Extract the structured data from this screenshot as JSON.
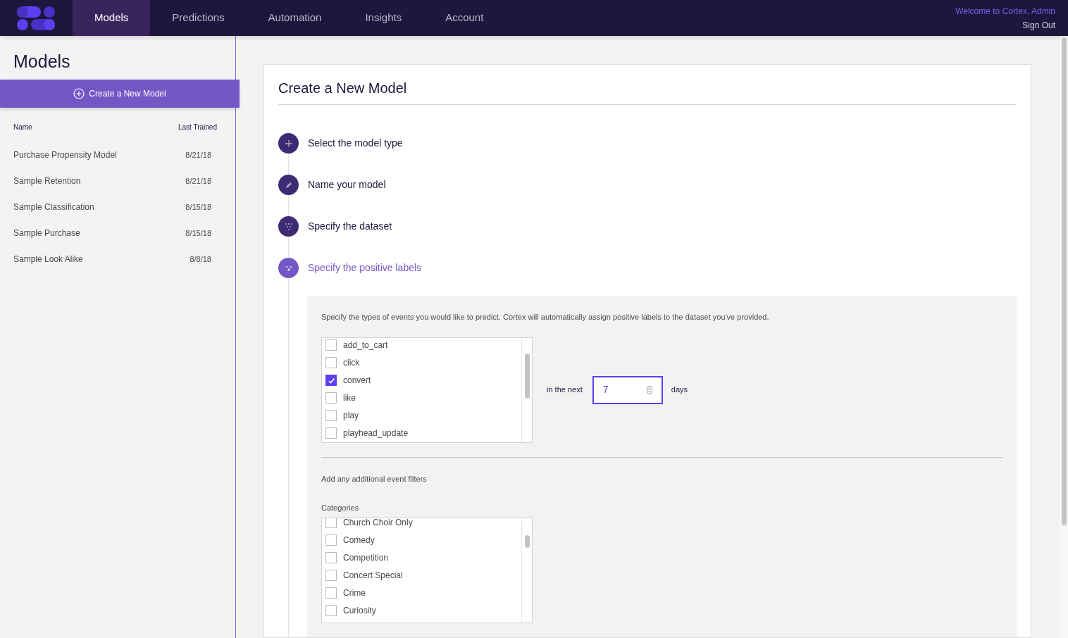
{
  "nav": {
    "tabs": [
      {
        "label": "Models",
        "selected": true
      },
      {
        "label": "Predictions",
        "selected": false
      },
      {
        "label": "Automation",
        "selected": false
      },
      {
        "label": "Insights",
        "selected": false
      },
      {
        "label": "Account",
        "selected": false
      }
    ],
    "welcome": "Welcome to Cortex, Admin",
    "sign_out": "Sign Out"
  },
  "sidebar": {
    "title": "Models",
    "create_button": "Create a New Model",
    "columns": [
      "Name",
      "Last Trained"
    ],
    "rows": [
      {
        "name": "Purchase Propensity Model",
        "last_trained": "8/21/18"
      },
      {
        "name": "Sample Retention",
        "last_trained": "8/21/18"
      },
      {
        "name": "Sample Classification",
        "last_trained": "8/15/18"
      },
      {
        "name": "Sample Purchase",
        "last_trained": "8/15/18"
      },
      {
        "name": "Sample Look Alike",
        "last_trained": "8/8/18"
      }
    ]
  },
  "form": {
    "title": "Create a New Model",
    "steps": [
      {
        "kind": "plus",
        "label": "Select the model type",
        "selected": false
      },
      {
        "kind": "pencil",
        "label": "Name your model",
        "selected": false
      },
      {
        "kind": "dataset",
        "label": "Specify the dataset",
        "selected": false
      },
      {
        "kind": "labels",
        "label": "Specify the positive labels",
        "selected": true
      }
    ],
    "intro": "Specify the types of events you would like to predict. Cortex will automatically assign positive labels to the dataset you've provided.",
    "events": [
      {
        "label": "add_to_cart",
        "checked": false
      },
      {
        "label": "click",
        "checked": false
      },
      {
        "label": "convert",
        "checked": true
      },
      {
        "label": "like",
        "checked": false
      },
      {
        "label": "play",
        "checked": false
      },
      {
        "label": "playhead_update",
        "checked": false
      }
    ],
    "in_the_next": "in the next",
    "days_value": "7",
    "days": "days",
    "filters_label": "Add any additional event filters",
    "categories_label": "Categories",
    "categories": [
      {
        "label": "Church Choir Only",
        "checked": false
      },
      {
        "label": "Comedy",
        "checked": false
      },
      {
        "label": "Competition",
        "checked": false
      },
      {
        "label": "Concert Special",
        "checked": false
      },
      {
        "label": "Crime",
        "checked": false
      },
      {
        "label": "Curiosity",
        "checked": false
      }
    ]
  }
}
